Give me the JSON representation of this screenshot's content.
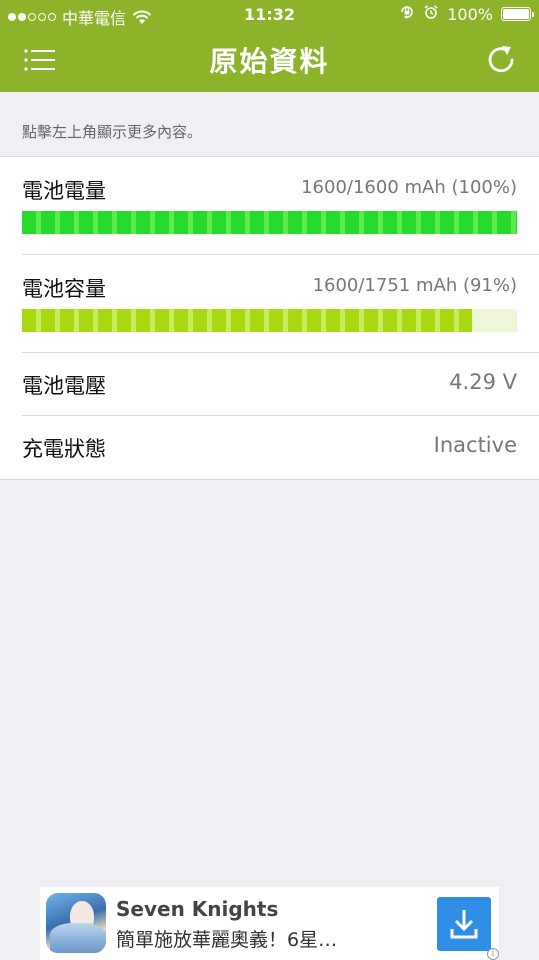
{
  "status_bar": {
    "carrier": "中華電信",
    "time": "11:32",
    "battery_percent_label": "100%",
    "battery_level": 1.0,
    "signal_bars_filled": 2,
    "signal_bars_total": 5
  },
  "nav": {
    "title": "原始資料",
    "menu_icon": "menu-list-icon",
    "refresh_icon": "refresh-icon"
  },
  "hint": "點擊左上角顯示更多內容。",
  "rows": [
    {
      "label": "電池電量",
      "value": "1600/1600 mAh (100%)",
      "progress": 1.0,
      "bar_color": "#25DA2A"
    },
    {
      "label": "電池容量",
      "value": "1600/1751 mAh (91%)",
      "progress": 0.91,
      "bar_color": "#A7D812"
    },
    {
      "label": "電池電壓",
      "value": "4.29 V"
    },
    {
      "label": "充電狀態",
      "value": "Inactive"
    }
  ],
  "ad": {
    "title": "Seven Knights",
    "description": "簡單施放華麗奧義！6星…",
    "download_icon": "download-icon",
    "info_glyph": "i"
  },
  "colors": {
    "header": "#8DB32B",
    "background": "#EFEFF4",
    "ad_button": "#2F8EE5"
  }
}
